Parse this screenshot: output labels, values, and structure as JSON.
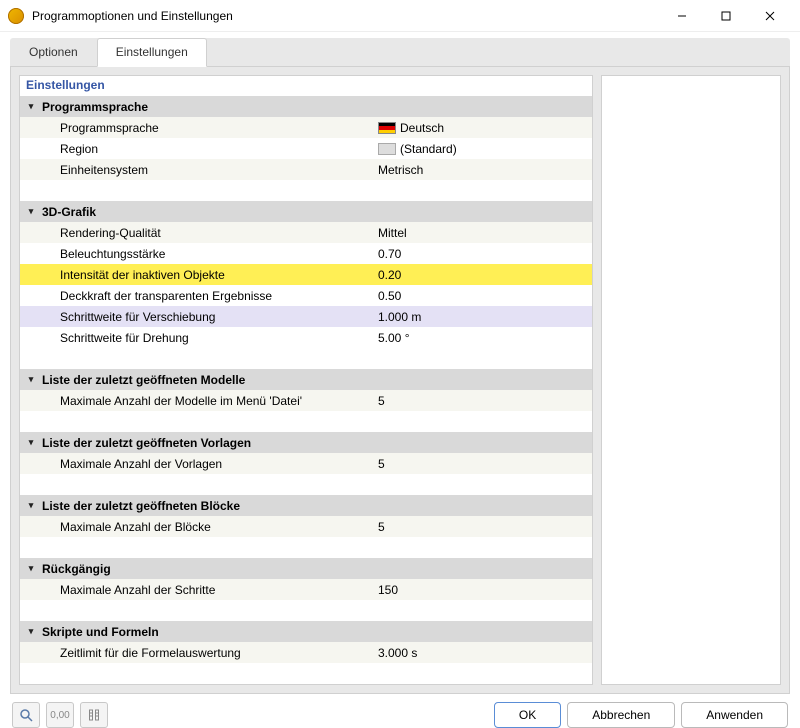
{
  "window": {
    "title": "Programmoptionen und Einstellungen"
  },
  "tabs": [
    {
      "label": "Optionen",
      "active": false
    },
    {
      "label": "Einstellungen",
      "active": true
    }
  ],
  "pane_title": "Einstellungen",
  "groups": [
    {
      "section": "Programmsprache",
      "rows": [
        {
          "label": "Programmsprache",
          "value": "Deutsch",
          "flag": "de"
        },
        {
          "label": "Region",
          "value": "(Standard)",
          "flag": "blank"
        },
        {
          "label": "Einheitensystem",
          "value": "Metrisch"
        }
      ]
    },
    {
      "section": "3D-Grafik",
      "rows": [
        {
          "label": "Rendering-Qualität",
          "value": "Mittel"
        },
        {
          "label": "Beleuchtungsstärke",
          "value": "0.70"
        },
        {
          "label": "Intensität der inaktiven Objekte",
          "value": "0.20",
          "highlight": true
        },
        {
          "label": "Deckkraft der transparenten Ergebnisse",
          "value": "0.50"
        },
        {
          "label": "Schrittweite für Verschiebung",
          "value": "1.000 m",
          "selected": true
        },
        {
          "label": "Schrittweite für Drehung",
          "value": "5.00 °"
        }
      ]
    },
    {
      "section": "Liste der zuletzt geöffneten Modelle",
      "rows": [
        {
          "label": "Maximale Anzahl der Modelle im Menü 'Datei'",
          "value": "5"
        }
      ]
    },
    {
      "section": "Liste der zuletzt geöffneten Vorlagen",
      "rows": [
        {
          "label": "Maximale Anzahl der Vorlagen",
          "value": "5"
        }
      ]
    },
    {
      "section": "Liste der zuletzt geöffneten Blöcke",
      "rows": [
        {
          "label": "Maximale Anzahl der Blöcke",
          "value": "5"
        }
      ]
    },
    {
      "section": "Rückgängig",
      "rows": [
        {
          "label": "Maximale Anzahl der Schritte",
          "value": "150"
        }
      ]
    },
    {
      "section": "Skripte und Formeln",
      "rows": [
        {
          "label": "Zeitlimit für die Formelauswertung",
          "value": "3.000 s"
        }
      ]
    }
  ],
  "footer": {
    "ok": "OK",
    "cancel": "Abbrechen",
    "apply": "Anwenden"
  }
}
